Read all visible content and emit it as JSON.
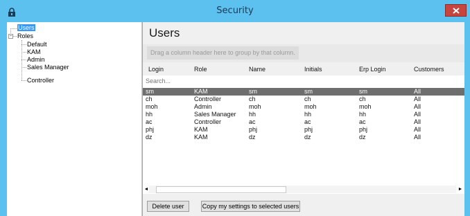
{
  "window": {
    "title": "Security",
    "app_icon": "lock-icon",
    "close_icon": "close-icon",
    "accent_color": "#5cc1ef",
    "close_color": "#c6463f"
  },
  "tree": {
    "root": "Users",
    "roles_label": "Roles",
    "roles_expander": "−",
    "roles": [
      "Default",
      "KAM",
      "Admin",
      "Sales Manager",
      "Controller"
    ]
  },
  "main": {
    "title": "Users",
    "group_hint": "Drag a column header here to group by that column.",
    "search_placeholder": "Search...",
    "columns": [
      "Login",
      "Role",
      "Name",
      "Initials",
      "Erp Login",
      "Customers"
    ],
    "rows": [
      [
        "sm",
        "KAM",
        "sm",
        "sm",
        "sm",
        "All"
      ],
      [
        "ch",
        "Controller",
        "ch",
        "ch",
        "ch",
        "All"
      ],
      [
        "moh",
        "Admin",
        "moh",
        "moh",
        "moh",
        "All"
      ],
      [
        "hh",
        "Sales Manager",
        "hh",
        "hh",
        "hh",
        "All"
      ],
      [
        "ac",
        "Controller",
        "ac",
        "ac",
        "ac",
        "All"
      ],
      [
        "phj",
        "KAM",
        "phj",
        "phj",
        "phj",
        "All"
      ],
      [
        "dz",
        "KAM",
        "dz",
        "dz",
        "dz",
        "All"
      ]
    ],
    "selected_row": 0,
    "scroll_left_glyph": "◄",
    "scroll_right_glyph": "►",
    "delete_button": "Delete user",
    "copy_button": "Copy my settings to selected users"
  }
}
